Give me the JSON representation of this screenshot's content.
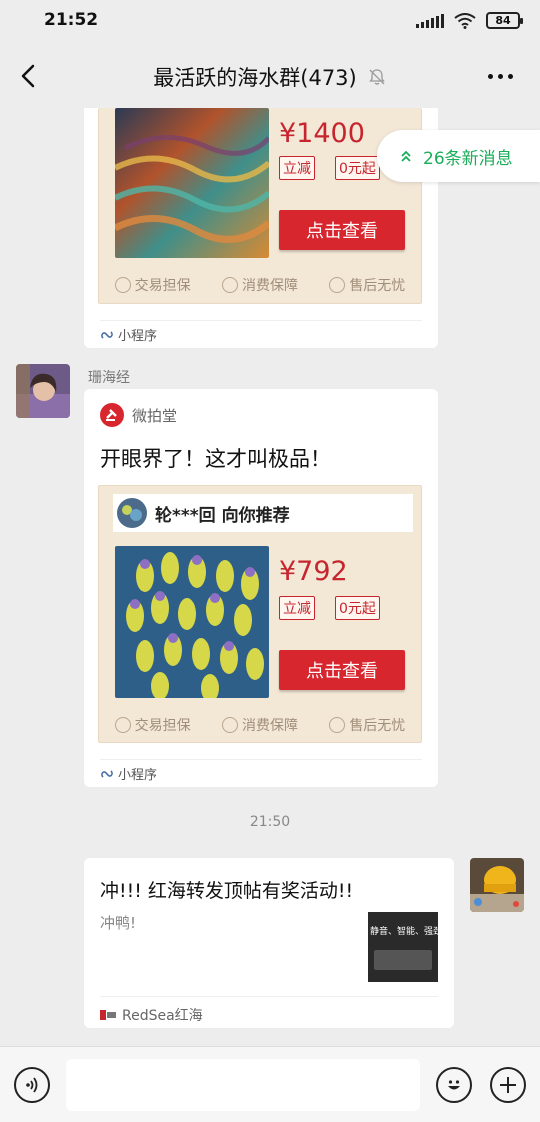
{
  "status": {
    "time": "21:52",
    "battery": "84"
  },
  "header": {
    "title": "最活跃的海水群(473)"
  },
  "new_messages": {
    "label": "26条新消息"
  },
  "card1": {
    "price": "¥1400",
    "tag1": "立减",
    "tag2": "0元起",
    "button": "点击查看",
    "guarantees": [
      "交易担保",
      "消费保障",
      "售后无忧"
    ],
    "source": "小程序"
  },
  "msg2": {
    "sender": "珊海经",
    "app_name": "微拍堂",
    "text": "开眼界了！这才叫极品！",
    "recommender": "轮***回 向你推荐",
    "price": "¥792",
    "tag1": "立减",
    "tag2": "0元起",
    "button": "点击查看",
    "guarantees": [
      "交易担保",
      "消费保障",
      "售后无忧"
    ],
    "source": "小程序"
  },
  "timestamp": "21:50",
  "msg3": {
    "title": "冲!!! 红海转发顶帖有奖活动!!",
    "desc": "冲鸭!",
    "thumb_text": "静音、智能、强劲",
    "source": "RedSea红海"
  },
  "colors": {
    "accent_green": "#1aad5a",
    "price_red": "#c7252e",
    "button_red": "#d8262f",
    "card_bg": "#f3e7d6"
  },
  "icons": [
    "back-icon",
    "mute-icon",
    "more-icon",
    "voice-icon",
    "emoji-icon",
    "plus-icon",
    "miniprogram-icon"
  ]
}
